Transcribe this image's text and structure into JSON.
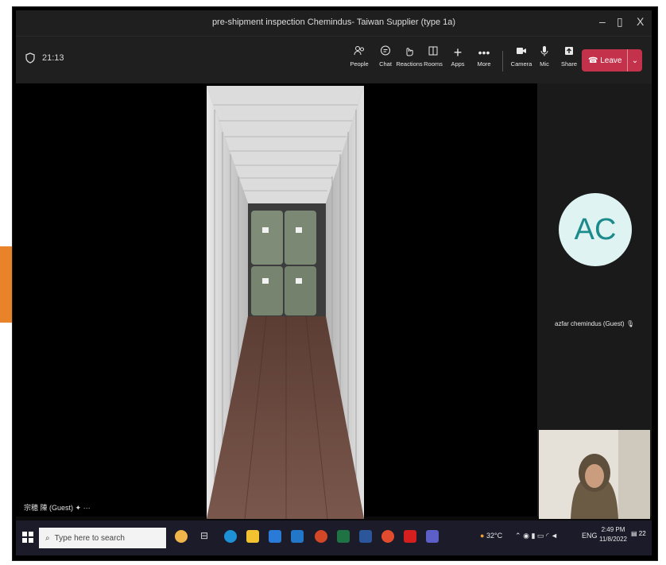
{
  "window": {
    "title": "pre-shipment inspection Chemindus- Taiwan Supplier (type 1a)",
    "controls": {
      "minimize": "–",
      "maximize": "▯",
      "close": "X"
    }
  },
  "toolbar": {
    "timer": "21:13",
    "items": [
      {
        "label": "People",
        "icon": "people-icon"
      },
      {
        "label": "Chat",
        "icon": "chat-icon"
      },
      {
        "label": "Reactions",
        "icon": "reactions-icon"
      },
      {
        "label": "Rooms",
        "icon": "rooms-icon"
      },
      {
        "label": "Apps",
        "icon": "plus-icon"
      },
      {
        "label": "More",
        "icon": "more-icon"
      },
      {
        "label": "Camera",
        "icon": "camera-icon"
      },
      {
        "label": "Mic",
        "icon": "mic-icon"
      },
      {
        "label": "Share",
        "icon": "share-icon"
      }
    ],
    "leave_label": "Leave"
  },
  "participants": {
    "remote": {
      "initials": "AC",
      "name": "azfar chemindus (Guest)"
    },
    "guest_label": "宗穂 陳 (Guest)"
  },
  "taskbar": {
    "search_placeholder": "Type here to search",
    "weather": "32°C",
    "language": "ENG",
    "time": "2:49 PM",
    "date": "11/8/2022",
    "notifications": "22"
  },
  "colors": {
    "leave": "#c4314b",
    "avatar_bg": "#dff3f3",
    "avatar_fg": "#1b8a8a",
    "arrow": "#e8832a"
  }
}
